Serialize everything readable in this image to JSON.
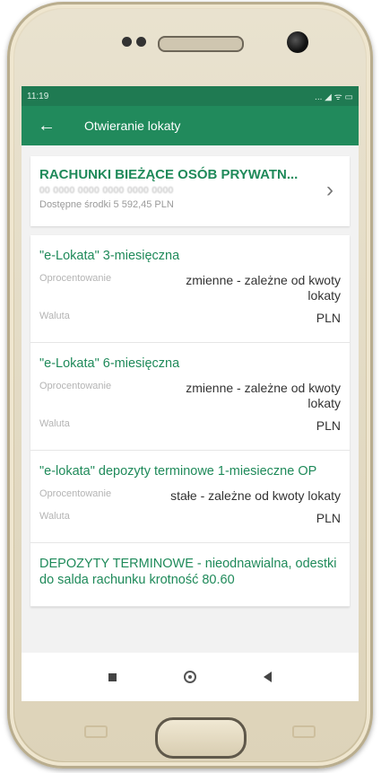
{
  "statusbar": {
    "time": "11:19",
    "icons": "... ◢ ᯤ ▭"
  },
  "appbar": {
    "back_icon": "←",
    "title": "Otwieranie lokaty"
  },
  "account": {
    "name": "RACHUNKI BIEŻĄCE OSÓB PRYWATN...",
    "number": "00 0000 0000 0000 0000 0000",
    "available": "Dostępne środki 5 592,45 PLN",
    "chevron": "›"
  },
  "offers": [
    {
      "title": "\"e-Lokata\" 3-miesięczna",
      "rate_label": "Oprocentowanie",
      "rate_value": "zmienne - zależne od kwoty lokaty",
      "currency_label": "Waluta",
      "currency_value": "PLN"
    },
    {
      "title": "\"e-Lokata\" 6-miesięczna",
      "rate_label": "Oprocentowanie",
      "rate_value": "zmienne - zależne od kwoty lokaty",
      "currency_label": "Waluta",
      "currency_value": "PLN"
    },
    {
      "title": "\"e-lokata\" depozyty terminowe 1-miesieczne OP",
      "rate_label": "Oprocentowanie",
      "rate_value": "stałe - zależne od kwoty lokaty",
      "currency_label": "Waluta",
      "currency_value": "PLN"
    },
    {
      "title": "DEPOZYTY TERMINOWE - nieodnawialna, odestki do salda rachunku krotność 80.60"
    }
  ],
  "colors": {
    "statusbar": "#1f7a52",
    "appbar": "#218a5c",
    "accent_text": "#1f8a5a"
  }
}
